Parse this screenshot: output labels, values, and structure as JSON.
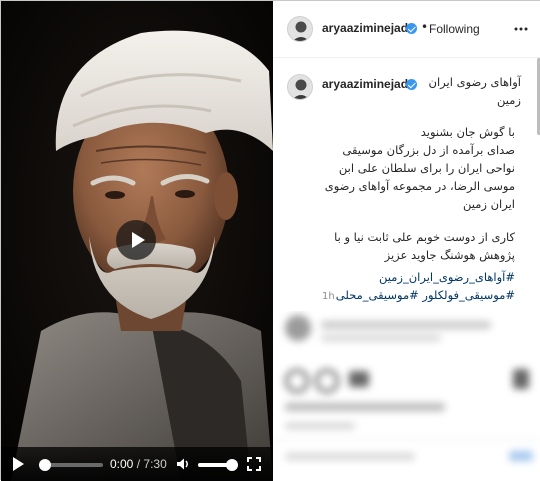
{
  "video": {
    "time_current": "0:00",
    "time_separator": "/",
    "time_duration": "7:30",
    "progress_fraction": 0.0,
    "volume_fraction": 1.0
  },
  "header": {
    "username": "aryaaziminejad",
    "separator": "•",
    "follow_state": "Following"
  },
  "caption": {
    "username": "aryaaziminejad",
    "title_line1": "آواهای رضوی ایران",
    "title_line2": "زمین",
    "body": [
      "با گوش جان بشنوید",
      "صدای برآمده از دل بزرگان موسیقی",
      "نواحی ایران را برای سلطان علی ابن",
      "موسی الرضا، در مجموعه آواهای رضوی",
      "ایران زمین"
    ],
    "credits": [
      "کاری از دوست خوبم علی ثابت نیا و با",
      "پژوهش هوشنگ جاوید عزیز"
    ],
    "hashtags_line1": "#آواهای_رضوی_ایران_زمین",
    "hashtags_line2": "#موسیقی_فولکلور #موسیقی_محلی",
    "time_ago": "1h"
  },
  "colors": {
    "verified_badge": "#3897f0",
    "hashtag": "#003569",
    "text": "#262626",
    "muted": "#8e8e8e"
  },
  "icons": [
    "play-icon",
    "volume-icon",
    "fullscreen-icon",
    "verified-icon",
    "more-options-icon"
  ]
}
